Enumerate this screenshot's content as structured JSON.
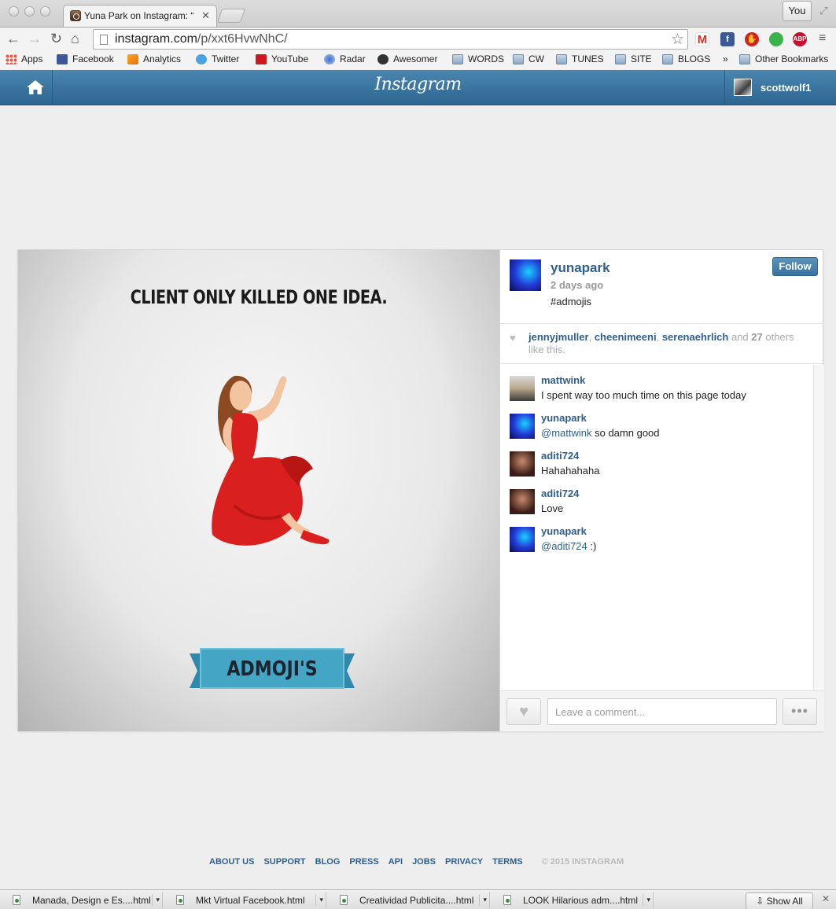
{
  "browser": {
    "tab_title": "Yuna Park on Instagram: “",
    "profile_button": "You",
    "url_host": "instagram.com",
    "url_path": "/p/xxt6HvwNhC/",
    "bookmarks": [
      "Apps",
      "Facebook",
      "Analytics",
      "Twitter",
      "YouTube",
      "Radar",
      "Awesomer",
      "WORDS",
      "CW",
      "TUNES",
      "SITE",
      "BLOGS",
      "»",
      "Other Bookmarks"
    ]
  },
  "header": {
    "logo": "Instagram",
    "current_user": "scottwolf1"
  },
  "post": {
    "image_headline": "CLIENT ONLY KILLED ONE IDEA.",
    "image_banner": "ADMOJI'S",
    "author": "yunapark",
    "time": "2 days ago",
    "caption": "#admojis",
    "follow_label": "Follow",
    "likes": {
      "names": [
        "jennyjmuller",
        "cheenimeeni",
        "serenaehrlich"
      ],
      "count": "27",
      "sep": ", ",
      "and_text": " and ",
      "suffix": " others like this."
    },
    "comments": [
      {
        "user": "mattwink",
        "mention": "",
        "text": "I spent way too much time on this page today"
      },
      {
        "user": "yunapark",
        "mention": "@mattwink",
        "text": " so damn good"
      },
      {
        "user": "aditi724",
        "mention": "",
        "text": "Hahahahaha"
      },
      {
        "user": "aditi724",
        "mention": "",
        "text": "Love"
      },
      {
        "user": "yunapark",
        "mention": "@aditi724",
        "text": " :)"
      }
    ],
    "comment_placeholder": "Leave a comment..."
  },
  "footer": {
    "links": [
      "ABOUT US",
      "SUPPORT",
      "BLOG",
      "PRESS",
      "API",
      "JOBS",
      "PRIVACY",
      "TERMS"
    ],
    "copyright": "© 2015 INSTAGRAM"
  },
  "downloads": {
    "items": [
      "Manada, Design e Es....html",
      "Mkt Virtual Facebook.html",
      "Creatividad Publicita....html",
      "LOOK Hilarious adm....html"
    ],
    "show_all": "Show All"
  },
  "colors": {
    "header_blue": "#2d6690",
    "link_blue": "#2f5f8e",
    "dress_red": "#d9201e",
    "banner_teal": "#44a5c5"
  }
}
